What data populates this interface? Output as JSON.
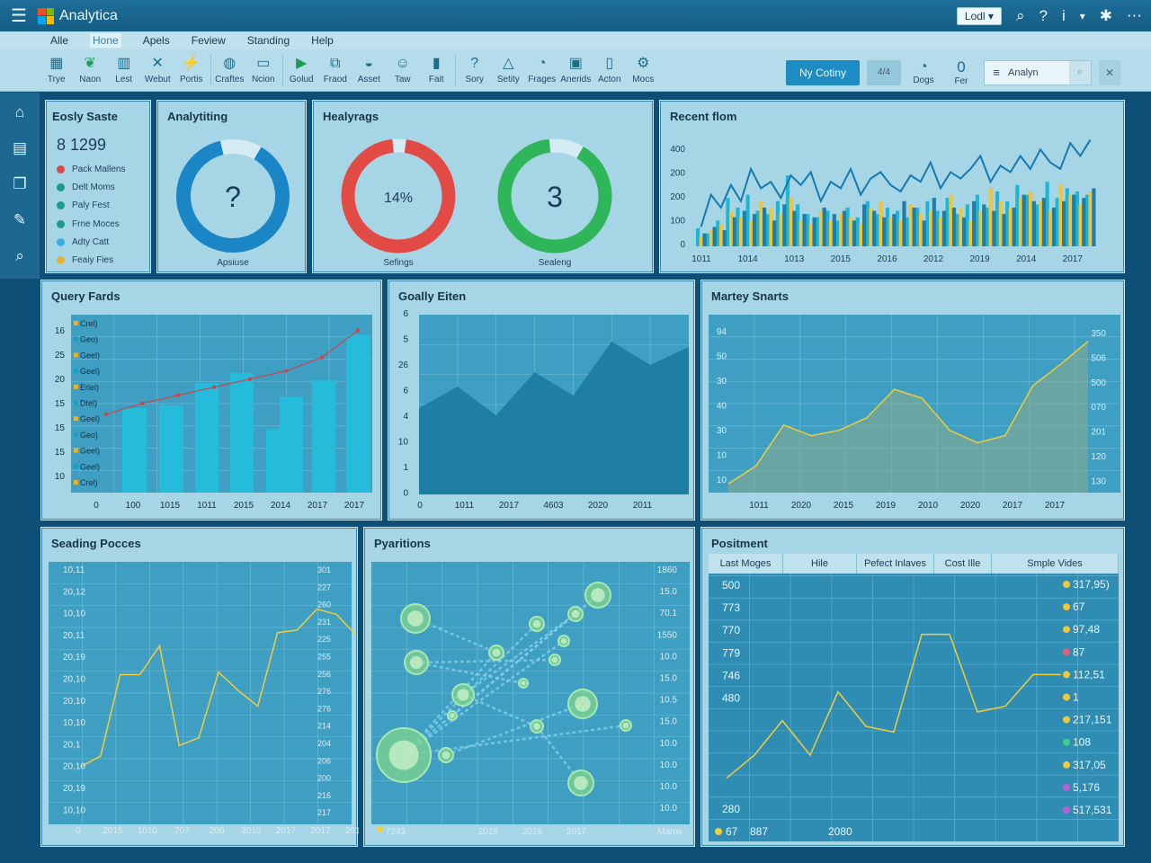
{
  "app": {
    "title": "Analytica",
    "load_label": "Lodl"
  },
  "menu": [
    "Alle",
    "Hone",
    "Apels",
    "Feview",
    "Standing",
    "Help"
  ],
  "toolbar": {
    "tools": [
      {
        "label": "Trye",
        "icon": "grid-icon"
      },
      {
        "label": "Naon",
        "icon": "leaf-icon"
      },
      {
        "label": "Lest",
        "icon": "bar-icon"
      },
      {
        "label": "Webut",
        "icon": "cross-icon"
      },
      {
        "label": "Portis",
        "icon": "wand-icon"
      },
      {
        "label": "Craftes",
        "icon": "globe-icon"
      },
      {
        "label": "Ncion",
        "icon": "screen-icon"
      },
      {
        "label": "Golud",
        "icon": "play-icon"
      },
      {
        "label": "Fraod",
        "icon": "shapes-icon"
      },
      {
        "label": "Asset",
        "icon": "bowl-icon"
      },
      {
        "label": "Taw",
        "icon": "smile-icon"
      },
      {
        "label": "Fait",
        "icon": "book-icon"
      },
      {
        "label": "Sory",
        "icon": "question-icon"
      },
      {
        "label": "Setity",
        "icon": "triangle-icon"
      },
      {
        "label": "Frages",
        "icon": "pie-icon"
      },
      {
        "label": "Anerids",
        "icon": "picture-icon"
      },
      {
        "label": "Acton",
        "icon": "doc-icon"
      },
      {
        "label": "Mocs",
        "icon": "gear-icon"
      }
    ],
    "primary_button": "Ny Cotiny",
    "small_button": "4/4",
    "dogs_label": "Dogs",
    "fear_label": "Fer",
    "fear_value": "0",
    "search_value": "Analyn"
  },
  "panel_easy": {
    "title": "Eosly Saste",
    "big_number": "8 1299",
    "items": [
      {
        "label": "Pack Mallens",
        "color": "#d94848"
      },
      {
        "label": "Delt Moms",
        "color": "#1e9a8c"
      },
      {
        "label": "Paly Fest",
        "color": "#1e9a8c"
      },
      {
        "label": "Frne Moces",
        "color": "#1e9a8c"
      },
      {
        "label": "Adty Catt",
        "color": "#3aaee0"
      },
      {
        "label": "Feaiy Fies",
        "color": "#e7b231"
      }
    ]
  },
  "panel_analytiting": {
    "title": "Analytiting",
    "center": "?",
    "caption": "Apsiuse",
    "fraction": 0.88
  },
  "panel_healyrags": {
    "title": "Healyrags",
    "donut1": {
      "center": "14%",
      "caption": "Sefings",
      "fraction": 0.96
    },
    "donut2": {
      "center": "3",
      "caption": "Sealeng",
      "fraction": 0.9
    }
  },
  "panel_recent": {
    "title": "Recent flom"
  },
  "panel_query": {
    "title": "Query Fards"
  },
  "panel_goally": {
    "title": "Goally Eiten"
  },
  "panel_martey": {
    "title": "Martey Snarts"
  },
  "panel_seading": {
    "title": "Seading Pocces"
  },
  "panel_pyaritions": {
    "title": "Pyaritions"
  },
  "panel_positment": {
    "title": "Positment",
    "columns": [
      "Last Moges",
      "Hile",
      "Pefect Inlaves",
      "Cost Ille",
      "Smple Vides"
    ],
    "left_values": [
      "500",
      "773",
      "770",
      "779",
      "746",
      "480"
    ],
    "right_values": [
      {
        "text": "317,95)",
        "color": "#f0c63a"
      },
      {
        "text": "67",
        "color": "#f0c63a"
      },
      {
        "text": "97,48",
        "color": "#f0c63a"
      },
      {
        "text": "87",
        "color": "#e0607a"
      },
      {
        "text": "112,51",
        "color": "#f0c63a"
      },
      {
        "text": "1",
        "color": "#f0c63a"
      },
      {
        "text": "217,151",
        "color": "#f0c63a"
      },
      {
        "text": "108",
        "color": "#3ad08a"
      },
      {
        "text": "317,05",
        "color": "#f0c63a"
      },
      {
        "text": "5,176",
        "color": "#b85fd1"
      },
      {
        "text": "517,531",
        "color": "#b85fd1"
      }
    ],
    "bottom_left": "280",
    "footer": [
      "67",
      "887",
      "2080"
    ]
  },
  "chart_data": [
    {
      "type": "bar",
      "title": "Recent flom",
      "y_ticks": [
        "400",
        "200",
        "200",
        "100",
        "0"
      ],
      "x_ticks": [
        "1011",
        "1014",
        "1013",
        "2015",
        "2016",
        "2012",
        "2019",
        "2014",
        "2017"
      ],
      "series": [
        {
          "color": "#1fb6d4",
          "values": [
            28,
            20,
            40,
            75,
            60,
            80,
            55,
            50,
            70,
            110,
            65,
            50,
            45,
            55,
            40,
            60,
            45,
            70,
            50,
            60,
            55,
            45,
            60,
            70,
            55,
            75,
            50,
            65,
            80,
            60,
            85,
            70,
            95,
            80,
            65,
            100,
            75,
            90,
            85,
            80
          ]
        },
        {
          "color": "#f2c33d",
          "values": [
            15,
            25,
            35,
            55,
            45,
            40,
            70,
            60,
            50,
            75,
            40,
            35,
            55,
            40,
            50,
            45,
            35,
            60,
            70,
            45,
            40,
            65,
            50,
            55,
            45,
            80,
            60,
            40,
            55,
            90,
            70,
            60,
            75,
            85,
            70,
            55,
            95,
            80,
            65,
            85
          ]
        },
        {
          "color": "#1f7ea8",
          "values": [
            20,
            30,
            25,
            45,
            55,
            50,
            60,
            40,
            65,
            55,
            50,
            45,
            60,
            50,
            55,
            40,
            65,
            55,
            45,
            50,
            70,
            60,
            40,
            75,
            55,
            60,
            45,
            70,
            65,
            55,
            50,
            60,
            80,
            70,
            75,
            60,
            70,
            80,
            75,
            90
          ]
        }
      ],
      "trend": [
        30,
        80,
        60,
        95,
        70,
        120,
        90,
        100,
        75,
        110,
        95,
        115,
        70,
        100,
        90,
        120,
        80,
        105,
        115,
        95,
        85,
        110,
        100,
        130,
        90,
        115,
        105,
        120,
        140,
        100,
        125,
        115,
        140,
        120,
        150,
        130,
        120,
        160,
        140,
        165
      ]
    },
    {
      "type": "bar",
      "title": "Query Fards",
      "y_ticks": [
        "16",
        "25",
        "20",
        "15",
        "15",
        "15",
        "10"
      ],
      "x_ticks": [
        "0",
        "100",
        "1015",
        "1011",
        "2015",
        "2014",
        "2017",
        "2017"
      ],
      "legend": [
        "Crel)",
        "Geo)",
        "Geel)",
        "Geel)",
        "Erlel)",
        "Dtel)",
        "Geel)",
        "Geo)",
        "Geel)",
        "Geel)",
        "Crel)"
      ],
      "values": [
        60,
        62,
        78,
        85,
        45,
        68,
        80,
        112
      ],
      "trend": [
        58,
        66,
        72,
        78,
        84,
        90,
        100,
        120
      ]
    },
    {
      "type": "area",
      "title": "Goally Eiten",
      "y_ticks": [
        "6",
        "5",
        "26",
        "6",
        "4",
        "10",
        "1",
        "0"
      ],
      "x_ticks": [
        "0",
        "1011",
        "2017",
        "4603",
        "2020",
        "2011"
      ],
      "values": [
        48,
        60,
        44,
        68,
        55,
        85,
        72,
        82
      ]
    },
    {
      "type": "area",
      "title": "Martey Snarts",
      "y_ticks_left": [
        "94",
        "50",
        "30",
        "40",
        "30",
        "10",
        "10"
      ],
      "y_ticks_right": [
        "350",
        "506",
        "500",
        "070",
        "201",
        "120",
        "130"
      ],
      "x_ticks": [
        "1011",
        "2020",
        "2015",
        "2019",
        "2010",
        "2020",
        "2017",
        "2017"
      ],
      "values": [
        5,
        15,
        38,
        32,
        35,
        42,
        58,
        53,
        35,
        28,
        32,
        60,
        72,
        85
      ]
    },
    {
      "type": "line",
      "title": "Seading Pocces",
      "y_ticks_left": [
        "10,11",
        "20,12",
        "10,10",
        "20,11",
        "20,19",
        "20,10",
        "20,10",
        "10,10",
        "20,1",
        "20,10",
        "20,19",
        "10,10"
      ],
      "y_ticks_right": [
        "301",
        "227",
        "260",
        "231",
        "225",
        "255",
        "256",
        "276",
        "276",
        "214",
        "204",
        "206",
        "200",
        "216",
        "217"
      ],
      "x_ticks": [
        "0",
        "2015",
        "1010",
        "707",
        "200",
        "2010",
        "2017",
        "2017",
        "2010"
      ],
      "values": [
        22,
        26,
        57,
        57,
        68,
        30,
        33,
        58,
        51,
        45,
        73,
        74,
        82,
        80,
        72
      ]
    },
    {
      "type": "table",
      "title": "Pyaritions",
      "y_ticks_right": [
        "1860",
        "15.0",
        "70.1",
        "1550",
        "10.0",
        "15.0",
        "10.5",
        "15.0",
        "10.0",
        "10.0",
        "10.0",
        "10.0"
      ],
      "x_ticks": [
        "7243",
        "2018",
        "2016",
        "2017",
        "Mams"
      ]
    },
    {
      "type": "line",
      "title": "Positment",
      "values": [
        22,
        30,
        42,
        30,
        52,
        40,
        38,
        72,
        72,
        45,
        47,
        58,
        58
      ]
    }
  ]
}
